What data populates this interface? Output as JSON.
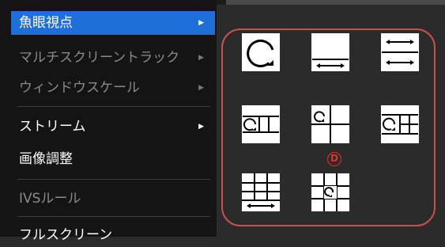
{
  "menu": {
    "items": [
      {
        "label": "魚眼視点",
        "arrow": "▶"
      },
      {
        "label": "マルチスクリーントラック",
        "arrow": "▶"
      },
      {
        "label": "ウィンドウスケール",
        "arrow": "▶"
      },
      {
        "label": "ストリーム",
        "arrow": "▶"
      },
      {
        "label": "画像調整"
      },
      {
        "label": "IVSルール"
      },
      {
        "label": "フルスクリーン"
      }
    ]
  },
  "layouts": {
    "annotation_marker": "D",
    "options": [
      {
        "icon": "fisheye-original-icon"
      },
      {
        "icon": "panorama-single-icon"
      },
      {
        "icon": "panorama-dual-icon"
      },
      {
        "icon": "fisheye-plus-3-ptz-icon"
      },
      {
        "icon": "fisheye-plus-3-quad-icon"
      },
      {
        "icon": "fisheye-plus-8-icon"
      },
      {
        "icon": "panorama-plus-8-icon"
      },
      {
        "icon": "fisheye-center-plus-8-icon"
      }
    ]
  },
  "colors": {
    "menu_bg": "#141414",
    "selected_bg": "#1e6fd9",
    "disabled_text": "#8a8a8a",
    "highlight_border": "#c8504e",
    "marker": "#e3312a"
  }
}
